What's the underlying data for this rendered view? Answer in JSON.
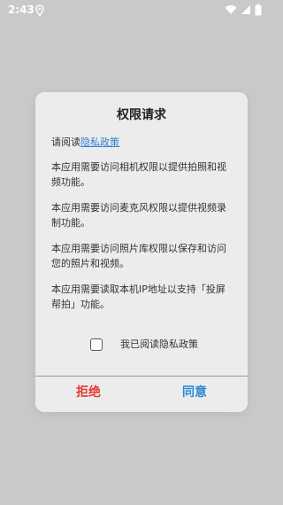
{
  "status_bar": {
    "time": "2:43"
  },
  "dialog": {
    "title": "权限请求",
    "intro_prefix": "请阅读",
    "privacy_link_text": "隐私政策",
    "paragraphs": [
      "本应用需要访问相机权限以提供拍照和视频功能。",
      "本应用需要访问麦克风权限以提供视频录制功能。",
      "本应用需要访问照片库权限以保存和访问您的照片和视频。",
      "本应用需要读取本机IP地址以支持「投屏帮拍」功能。"
    ],
    "checkbox_label": "我已阅读隐私政策",
    "checkbox_checked": false,
    "refuse_label": "拒绝",
    "agree_label": "同意"
  },
  "colors": {
    "background_dim": "#c9c9c9",
    "dialog_bg": "#ececec",
    "link": "#2f7fd3",
    "refuse": "#e53935",
    "agree": "#2a86d9"
  },
  "icons": {
    "status_left": "location-icon",
    "status_right": [
      "wifi-icon",
      "cellular-signal-icon",
      "battery-icon"
    ]
  }
}
